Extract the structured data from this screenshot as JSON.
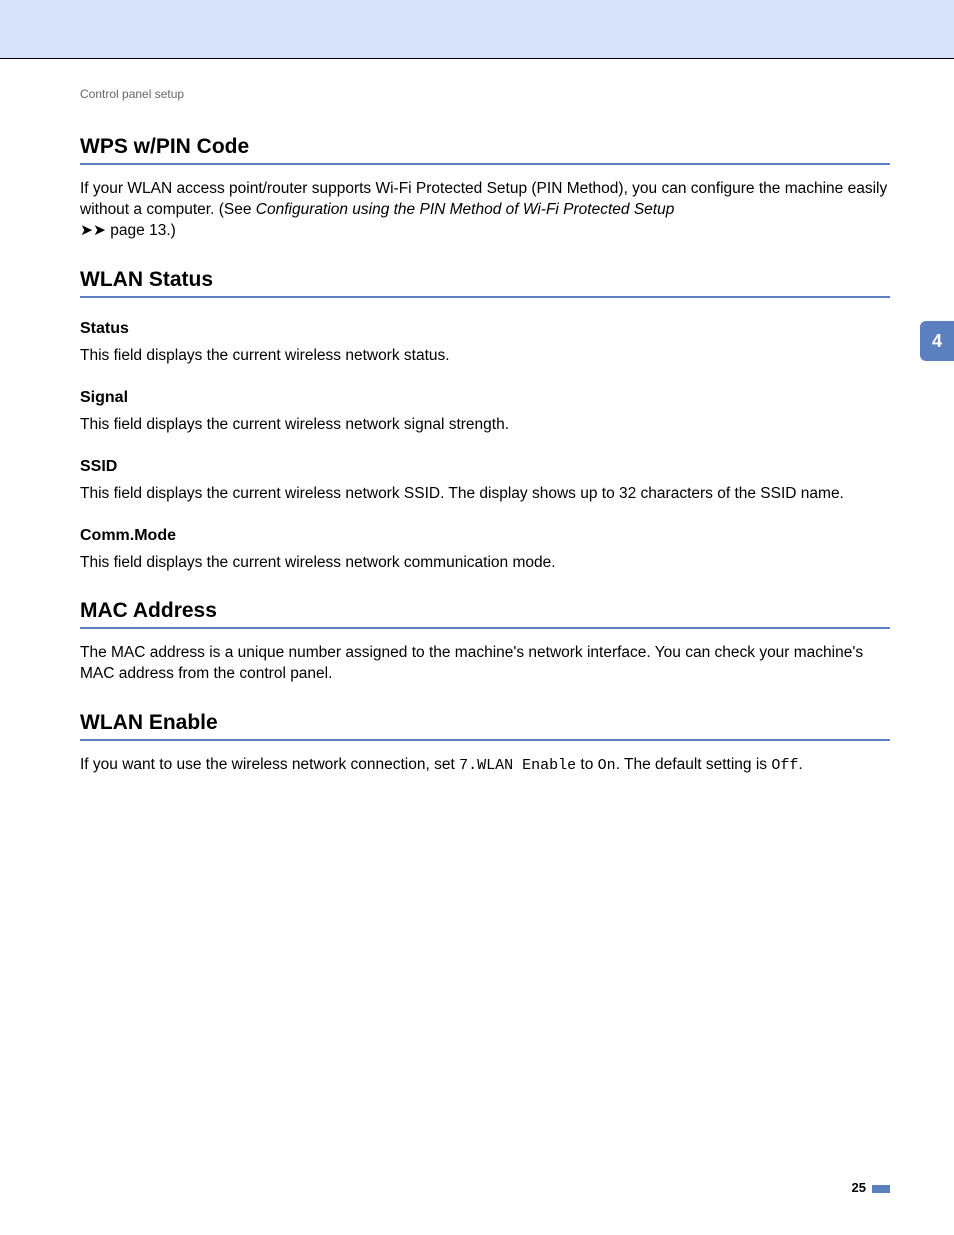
{
  "breadcrumb": "Control panel setup",
  "side_tab": "4",
  "page_number": "25",
  "sections": {
    "wps": {
      "title": "WPS w/PIN Code",
      "p1a": "If your WLAN access point/router supports Wi-Fi Protected Setup (PIN Method), you can configure the machine easily without a computer. (See ",
      "p1b_italic": "Configuration using the PIN Method of Wi-Fi Protected Setup",
      "p1c": " page 13.)",
      "arrows": "➤➤"
    },
    "wlan_status": {
      "title": "WLAN Status",
      "status_h": "Status",
      "status_p": "This field displays the current wireless network status.",
      "signal_h": "Signal",
      "signal_p": "This field displays the current wireless network signal strength.",
      "ssid_h": "SSID",
      "ssid_p": "This field displays the current wireless network SSID. The display shows up to 32 characters of the SSID name.",
      "comm_h": "Comm.Mode",
      "comm_p": "This field displays the current wireless network communication mode."
    },
    "mac": {
      "title": "MAC Address",
      "p": "The MAC address is a unique number assigned to the machine's network interface. You can check your machine's MAC address from the control panel."
    },
    "wlan_enable": {
      "title": "WLAN Enable",
      "p1": "If you want to use the wireless network connection, set ",
      "mono1": "7.WLAN Enable",
      "p2": " to ",
      "mono2": "On",
      "p3": ". The default setting is ",
      "mono3": "Off",
      "p4": "."
    }
  }
}
